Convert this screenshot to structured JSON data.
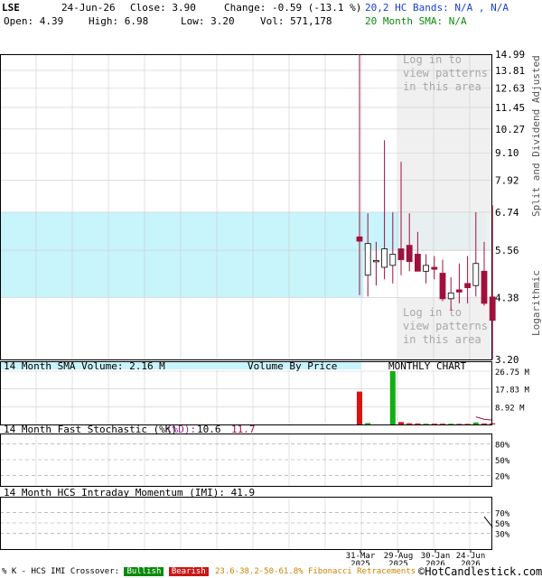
{
  "header": {
    "ticker": "LSE",
    "date": "24-Jun-26",
    "close_label": "Close: 3.90",
    "change_label": "Change: -0.59 (-13.1 %)",
    "bands_label": "20,2 HC Bands: N/A , N/A",
    "open_label": "Open: 4.39",
    "high_label": "High: 6.98",
    "low_label": "Low: 3.20",
    "vol_label": "Vol: 571,178",
    "sma_label": "20 Month SMA: N/A"
  },
  "chart_data": [
    {
      "type": "candlestick",
      "scale": "log",
      "ylim": [
        3.2,
        14.99
      ],
      "y_ticks": [
        "14.99",
        "13.81",
        "12.63",
        "11.45",
        "10.27",
        "9.10",
        "7.92",
        "6.74",
        "5.56",
        "4.38",
        "3.20"
      ],
      "right_labels": [
        "Split and Dividend Adjusted",
        "Logarithmic"
      ],
      "x_ticks": [
        "31-Mar 2025",
        "29-Aug 2025",
        "30-Jan 2026",
        "24-Jun 2026"
      ],
      "volume_by_price_label": "Volume By Price",
      "chart_title": "MONTHLY CHART",
      "overlay_text": [
        "Log in to",
        "view patterns",
        "in this area"
      ],
      "candles": [
        {
          "o": 5.95,
          "h": 14.99,
          "l": 4.43,
          "c": 5.82
        },
        {
          "o": 4.9,
          "h": 6.7,
          "l": 4.4,
          "c": 5.75
        },
        {
          "o": 5.28,
          "h": 5.8,
          "l": 4.65,
          "c": 5.28
        },
        {
          "o": 5.1,
          "h": 9.7,
          "l": 4.8,
          "c": 5.6
        },
        {
          "o": 5.15,
          "h": 6.74,
          "l": 4.7,
          "c": 5.45
        },
        {
          "o": 5.6,
          "h": 8.7,
          "l": 4.9,
          "c": 5.3
        },
        {
          "o": 5.7,
          "h": 6.7,
          "l": 5.0,
          "c": 5.25
        },
        {
          "o": 5.45,
          "h": 6.1,
          "l": 5.0,
          "c": 5.0
        },
        {
          "o": 5.0,
          "h": 5.45,
          "l": 4.7,
          "c": 5.15
        },
        {
          "o": 5.1,
          "h": 5.4,
          "l": 4.8,
          "c": 5.05
        },
        {
          "o": 4.95,
          "h": 5.3,
          "l": 4.3,
          "c": 4.35
        },
        {
          "o": 4.35,
          "h": 4.85,
          "l": 4.1,
          "c": 4.48
        },
        {
          "o": 4.55,
          "h": 5.2,
          "l": 4.25,
          "c": 4.5
        },
        {
          "o": 4.7,
          "h": 5.4,
          "l": 4.25,
          "c": 4.6
        },
        {
          "o": 4.65,
          "h": 6.74,
          "l": 4.4,
          "c": 5.2
        },
        {
          "o": 5.0,
          "h": 5.8,
          "l": 4.2,
          "c": 4.25
        },
        {
          "o": 4.39,
          "h": 6.98,
          "l": 3.2,
          "c": 3.9
        }
      ],
      "volume_by_price": [
        {
          "from": 5.56,
          "to": 6.74,
          "width": 0.99
        },
        {
          "from": 4.38,
          "to": 5.56,
          "width": 0.74
        }
      ]
    },
    {
      "type": "bar",
      "title": "14 Month SMA Volume: 2.16 M",
      "y_ticks": [
        "26.75 M",
        "17.83 M",
        "8.92 M"
      ],
      "values_m": [
        16.5,
        0.7,
        0,
        0,
        26.75,
        1.2,
        0.6,
        0.5,
        0.4,
        0.4,
        0.4,
        0.4,
        0.3,
        0.3,
        1.0,
        0.5,
        0.6
      ],
      "sma_m": [
        null,
        null,
        null,
        null,
        null,
        null,
        null,
        null,
        null,
        null,
        null,
        null,
        null,
        null,
        3.8,
        2.6,
        2.16
      ]
    },
    {
      "type": "line",
      "title_prefix": "14 Month Fast Stochastic (%K)",
      "title_d": "(%D):",
      "k_value": "10.6",
      "d_value": "11.7",
      "y_ticks": [
        "80%",
        "50%",
        "20%"
      ]
    },
    {
      "type": "line",
      "title": "14 Month HCS Intraday Momentum (IMI): 41.9",
      "y_ticks": [
        "70%",
        "50%",
        "30%"
      ],
      "values": [
        null,
        null,
        null,
        null,
        null,
        null,
        null,
        null,
        null,
        null,
        null,
        null,
        null,
        null,
        null,
        62,
        41.9
      ]
    }
  ],
  "legend": {
    "crossover": "% K - HCS IMI Crossover:",
    "bullish": "Bullish",
    "bearish": "Bearish",
    "fib": "23.6-38.2-50-61.8% Fibonacci Retracements",
    "brand": "©HotCandlestick.com"
  },
  "colors": {
    "up": "#ffffff",
    "down": "#a0103c",
    "vbp": "#c8f4fc",
    "shade": "#ededed",
    "vol_red": "#e01010",
    "vol_green": "#10b010",
    "grid": "#cccccc"
  }
}
